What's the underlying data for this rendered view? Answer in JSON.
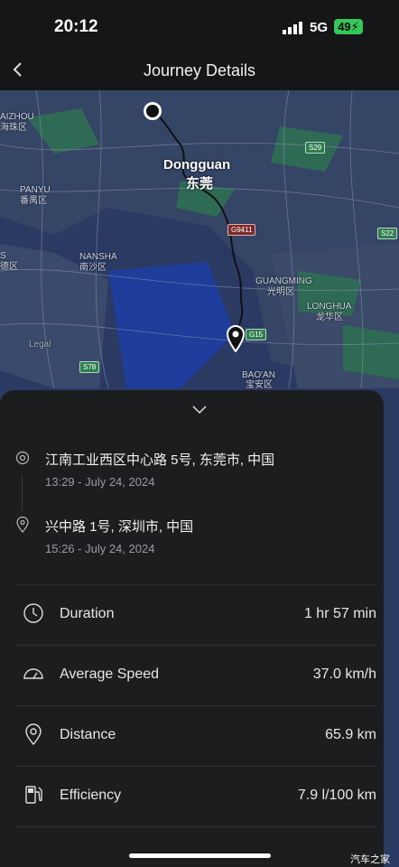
{
  "status_bar": {
    "time": "20:12",
    "network": "5G",
    "battery": "49"
  },
  "header": {
    "title": "Journey Details"
  },
  "map": {
    "labels": {
      "aizhou": "AIZHOU",
      "aizhou_cn": "海珠区",
      "panyu": "PANYU",
      "panyu_cn": "番禺区",
      "nansha": "NANSHA",
      "nansha_cn": "南沙区",
      "s_de": "S",
      "de_cn": "德区",
      "dongguan": "Dongguan",
      "dongguan_cn": "东莞",
      "guangming": "GUANGMING",
      "guangming_cn": "光明区",
      "longhua": "LONGHUA",
      "longhua_cn": "龙华区",
      "baoan": "BAO'AN",
      "baoan_cn": "宝安区",
      "legal": "Legal",
      "s29": "S29",
      "g9411": "G9411",
      "s22": "S22",
      "g15": "G15",
      "s78": "S78"
    }
  },
  "journey": {
    "start_address": "江南工业西区中心路 5号, 东莞市, 中国",
    "start_time": "13:29 - July 24, 2024",
    "end_address": "兴中路 1号, 深圳市, 中国",
    "end_time": "15:26 - July 24, 2024"
  },
  "stats": [
    {
      "label": "Duration",
      "value": "1 hr 57 min",
      "icon": "clock-icon"
    },
    {
      "label": "Average Speed",
      "value": "37.0 km/h",
      "icon": "speedometer-icon"
    },
    {
      "label": "Distance",
      "value": "65.9 km",
      "icon": "location-pin-icon"
    },
    {
      "label": "Efficiency",
      "value": "7.9 l/100 km",
      "icon": "fuel-pump-icon"
    }
  ],
  "watermark": "汽车之家"
}
